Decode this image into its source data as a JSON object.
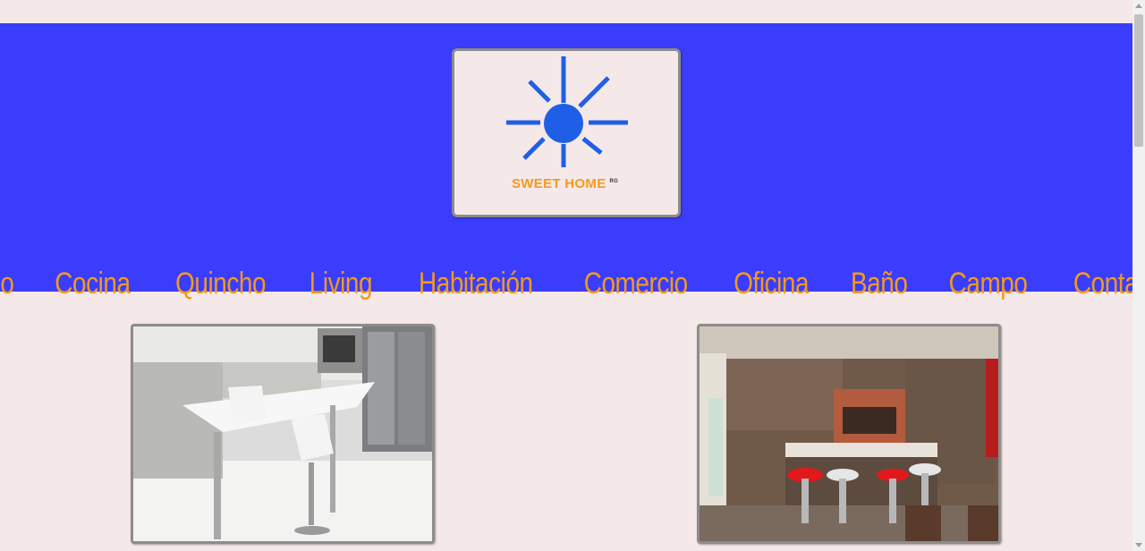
{
  "header": {
    "brand_name": "SWEET HOME",
    "brand_sup": "RG",
    "logo_icon": "sun-icon",
    "banner_color": "#3b3dfc",
    "accent_color": "#f39a1c"
  },
  "nav": {
    "items": [
      {
        "label": "Inicio"
      },
      {
        "label": "Cocina"
      },
      {
        "label": "Quincho"
      },
      {
        "label": "Living"
      },
      {
        "label": "Habitación"
      },
      {
        "label": "Comercio"
      },
      {
        "label": "Oficina"
      },
      {
        "label": "Baño"
      },
      {
        "label": "Campo"
      },
      {
        "label": "Contacto"
      }
    ]
  },
  "gallery": {
    "images": [
      {
        "subject": "white kitchen with bar stools"
      },
      {
        "subject": "wood kitchen with red and white stools"
      }
    ]
  }
}
